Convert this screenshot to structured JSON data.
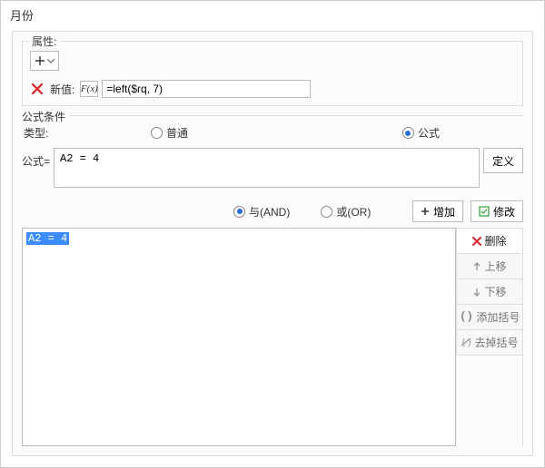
{
  "window": {
    "title": "月份"
  },
  "attr": {
    "legend": "属性:",
    "plus_tooltip": "add",
    "new_value_label": "新值:",
    "fx_label": "F(x)",
    "value": "=left($rq, 7)"
  },
  "cond": {
    "title": "公式条件",
    "type_label": "类型:",
    "type_normal": "普通",
    "type_formula": "公式",
    "type_selected": "formula",
    "formula_label": "公式=",
    "formula_value": "A2 = 4",
    "define_btn": "定义"
  },
  "logic": {
    "and_label": "与(AND)",
    "or_label": "或(OR)",
    "logic_selected": "and",
    "add_btn": "增加",
    "modify_btn": "修改"
  },
  "list": {
    "items": [
      "A2 = 4"
    ]
  },
  "side": {
    "delete": "删除",
    "move_up": "上移",
    "move_down": "下移",
    "add_paren": "添加括号",
    "remove_paren": "去掉括号"
  },
  "colors": {
    "accent": "#2a6fd6",
    "danger": "#d9252a",
    "mod_green": "#3fa540"
  }
}
